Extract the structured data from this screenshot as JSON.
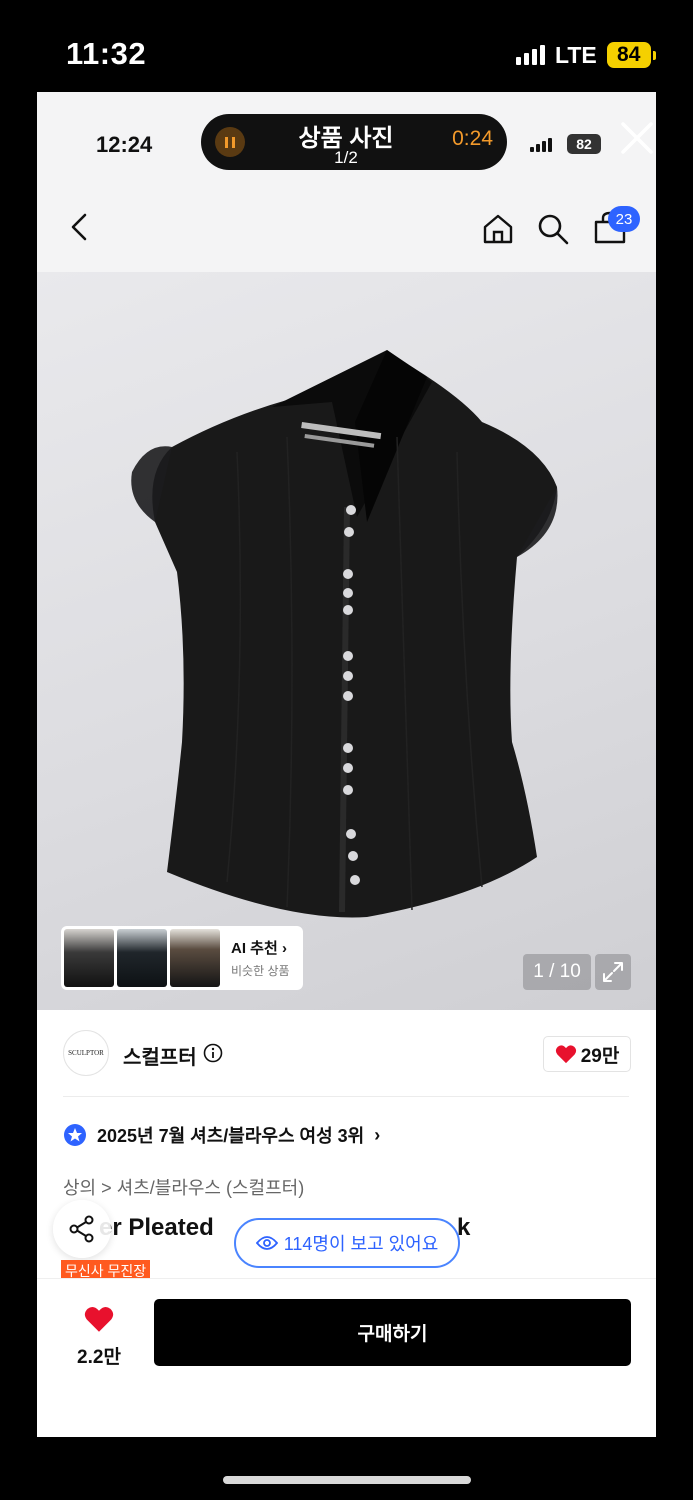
{
  "outer_status": {
    "time": "11:32",
    "network": "LTE",
    "battery": "84"
  },
  "inner_status": {
    "time": "12:24",
    "battery": "82"
  },
  "recording_pill": {
    "title": "상품 사진",
    "subtitle": "1/2",
    "timer": "0:24"
  },
  "header": {
    "cart_count": "23",
    "icons": [
      "back-icon",
      "home-icon",
      "search-icon",
      "cart-icon"
    ]
  },
  "gallery": {
    "counter": "1 / 10",
    "ai_card": {
      "title": "AI 추천",
      "subtitle": "비슷한 상품"
    }
  },
  "brand": {
    "logo_text": "SCULPTOR",
    "name": "스컬프터",
    "likes": "29만"
  },
  "ranking": {
    "text": "2025년 7월 셔츠/블라우스 여성 3위"
  },
  "breadcrumb": {
    "text": "상의 > 셔츠/블라우스 (스컬프터)"
  },
  "product": {
    "title_left": "er Pleated",
    "title_right": "k",
    "tag": "무신사 무진장"
  },
  "viewers": {
    "text": "114명이 보고 있어요"
  },
  "bottom_bar": {
    "like_count": "2.2만",
    "buy_label": "구매하기"
  },
  "colors": {
    "accent_blue": "#2e63ff",
    "heart_red": "#e8112d",
    "tag_orange": "#ff5a1f",
    "battery_yellow": "#f5d000"
  }
}
